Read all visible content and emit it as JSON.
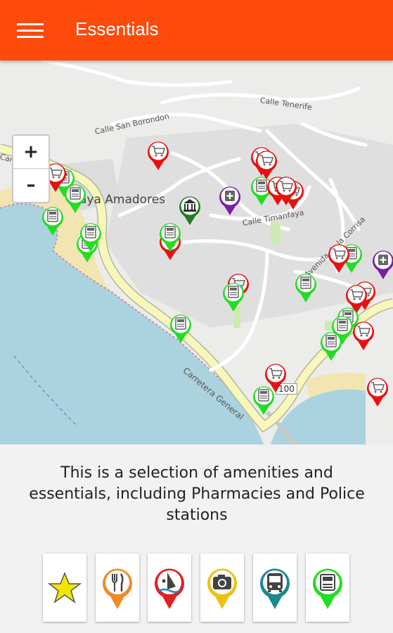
{
  "app": {
    "title": "Essentials",
    "menu_icon": "hamburger-menu-icon"
  },
  "map": {
    "zoom_in_label": "+",
    "zoom_out_label": "–",
    "streets": [
      "Calle Tenerife",
      "Calle San Borondon",
      "Calle Timanfaya",
      "Carretera General",
      "Carretera General",
      "Avenida de la Corrisa"
    ],
    "place_label": "Playa Amadores",
    "road_ref": "100",
    "pin_types": {
      "atm": {
        "icon": "atm-icon",
        "color": "#22dd22"
      },
      "shop": {
        "icon": "shopping-cart-icon",
        "color": "#e81010"
      },
      "pharmacy": {
        "icon": "pharmacy-icon",
        "color": "#7a1fa2"
      },
      "police": {
        "icon": "police-building-icon",
        "color": "#1e7d1e"
      }
    },
    "colors": {
      "sea": "#aad3df",
      "beach": "#f2e5b2",
      "land": "#ececea",
      "main_road": "#f7f7ba"
    }
  },
  "description": "This is a selection of amenities and essentials, including Pharmacies and Police stations",
  "categories": [
    {
      "name": "favorites",
      "icon": "star-icon",
      "color": "#f2e600"
    },
    {
      "name": "restaurants",
      "icon": "fork-knife-icon",
      "color": "#f08a28"
    },
    {
      "name": "water-sports",
      "icon": "windsurf-icon",
      "color": "#e02020"
    },
    {
      "name": "photo-spots",
      "icon": "camera-icon",
      "color": "#f0c010"
    },
    {
      "name": "transport",
      "icon": "bus-icon",
      "color": "#1a8a90"
    },
    {
      "name": "essentials",
      "icon": "atm-icon",
      "color": "#22dd22"
    }
  ]
}
